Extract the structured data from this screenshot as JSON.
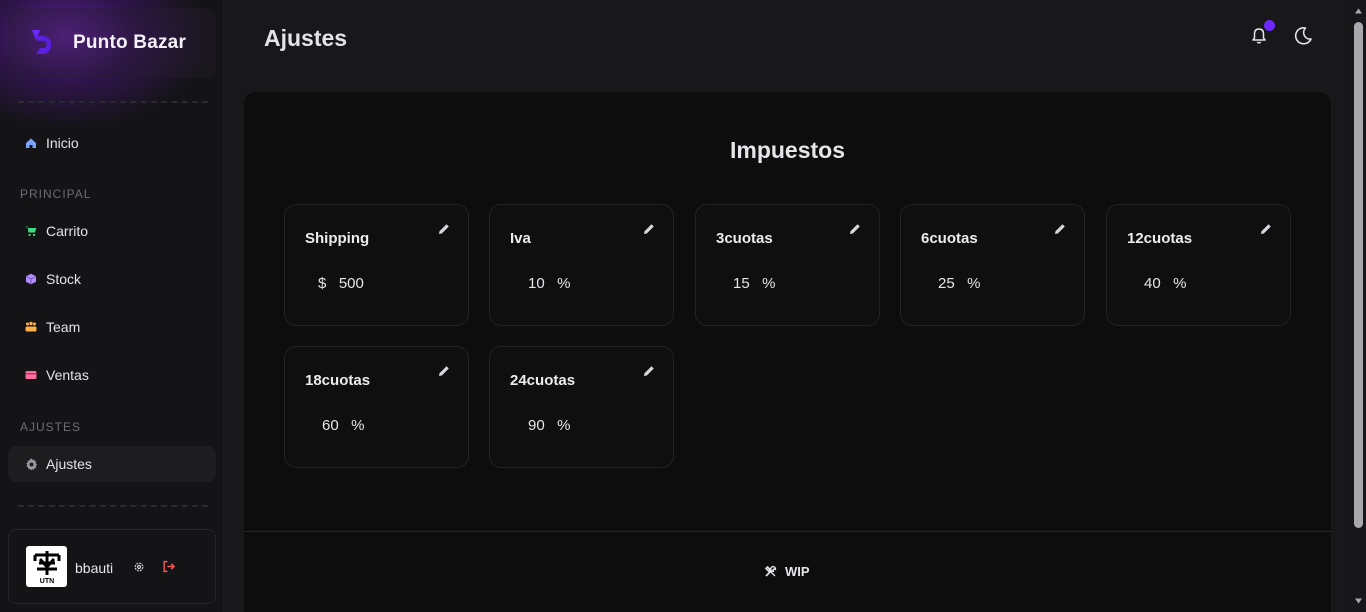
{
  "brand": {
    "name": "Punto Bazar",
    "accent": "#6d28ff"
  },
  "sidebar": {
    "home": {
      "label": "Inicio",
      "icon": "home-icon",
      "color": "#7aa2ff"
    },
    "section_principal": "PRINCIPAL",
    "items": [
      {
        "label": "Carrito",
        "icon": "cart-icon",
        "color": "#3ddc84"
      },
      {
        "label": "Stock",
        "icon": "cube-icon",
        "color": "#b38cff"
      },
      {
        "label": "Team",
        "icon": "team-icon",
        "color": "#ffb347"
      },
      {
        "label": "Ventas",
        "icon": "card-icon",
        "color": "#ff6b9a"
      }
    ],
    "section_ajustes": "AJUSTES",
    "settings": {
      "label": "Ajustes",
      "icon": "gear-icon",
      "color": "#9a9aa2"
    }
  },
  "user": {
    "name": "bbauti",
    "avatar_text": "UTN",
    "logout_color": "#ff5a5a"
  },
  "header": {
    "title": "Ajustes",
    "notification_dot": true
  },
  "main": {
    "title": "Impuestos",
    "cards": [
      {
        "name": "Shipping",
        "value": "$   500"
      },
      {
        "name": "Iva",
        "value": "10   %"
      },
      {
        "name": "3cuotas",
        "value": "15   %"
      },
      {
        "name": "6cuotas",
        "value": "25   %"
      },
      {
        "name": "12cuotas",
        "value": "40   %"
      },
      {
        "name": "18cuotas",
        "value": "60   %"
      },
      {
        "name": "24cuotas",
        "value": "90   %"
      }
    ],
    "footer": "WIP"
  }
}
